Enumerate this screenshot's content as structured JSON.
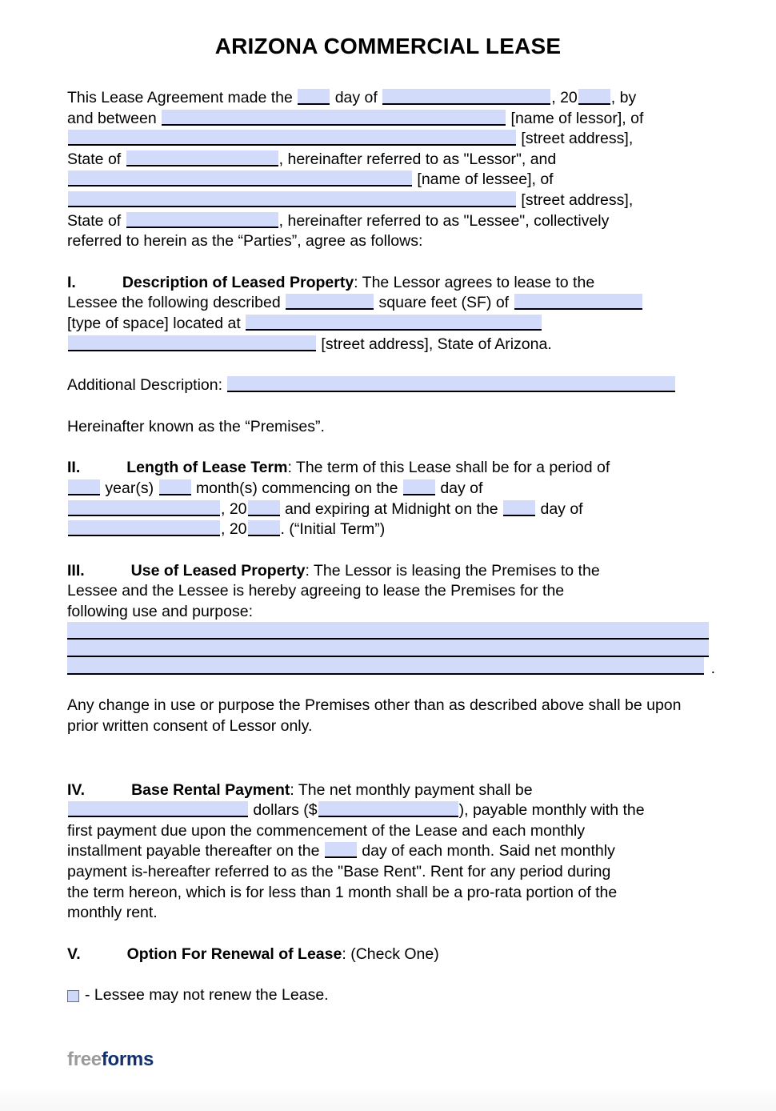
{
  "document": {
    "title": "ARIZONA COMMERCIAL LEASE"
  },
  "intro": {
    "l1_a": "This Lease Agreement made the",
    "l1_b": "day of",
    "l1_c": ", 20",
    "l1_d": ", by",
    "l2_a": "and between",
    "l2_b": "[name of lessor], of",
    "l3_b": "[street address],",
    "l4_a": "State of",
    "l4_b": ", hereinafter referred to as \"Lessor\", and",
    "l5_b": "[name of lessee], of",
    "l6_b": "[street address],",
    "l7_a": "State of",
    "l7_b": ", hereinafter referred to as \"Lessee\", collectively",
    "l8": "referred to herein as the “Parties”, agree as follows:"
  },
  "section_1": {
    "number": "I.",
    "heading": "Description of Leased Property",
    "t1": ": The Lessor agrees to lease to the",
    "t2": "Lessee the following described",
    "t3": "square feet (SF) of",
    "t4": "[type of space] located at",
    "t5": "[street address], State of Arizona."
  },
  "additional_description": {
    "label": "Additional Description:"
  },
  "premises_note": {
    "text": "Hereinafter known as the “Premises”."
  },
  "section_2": {
    "number": "II.",
    "heading": "Length of Lease Term",
    "t1": ": The term of this Lease shall be for a period of",
    "t2": "year(s)",
    "t3": "month(s) commencing on the",
    "t4": "day of",
    "t5": ", 20",
    "t6": "and expiring at Midnight on the",
    "t7": "day of",
    "t8": ", 20",
    "t9": ". (“Initial Term”)"
  },
  "section_3": {
    "number": "III.",
    "heading": "Use of Leased Property",
    "t1": ": The Lessor is leasing the Premises to the",
    "t2": "Lessee and the Lessee is hereby agreeing to lease the Premises for the",
    "t3": "following use and purpose:",
    "period": ".",
    "lines": 3,
    "after": "Any change in use or purpose the Premises other than as described above shall be upon prior written consent of Lessor only."
  },
  "section_4": {
    "number": "IV.",
    "heading": "Base Rental Payment",
    "t1": ": The net monthly payment shall be",
    "t2": "dollars ($",
    "t3": "), payable monthly with the",
    "t4": "first payment due upon the commencement of the Lease and each monthly",
    "t5": "installment payable thereafter on the",
    "t6": "day of each month. Said net monthly",
    "t7": "payment is-hereafter referred to as the \"Base Rent\". Rent for any period during",
    "t8": "the term hereon, which is for less than 1 month shall be a pro-rata portion of the",
    "t9": "monthly rent."
  },
  "section_5": {
    "number": "V.",
    "heading": "Option For Renewal of Lease",
    "t1": ": (Check One)",
    "option_1": "- Lessee may not renew the Lease."
  },
  "footer": {
    "logo_part1": "free",
    "logo_part2": "forms",
    "color_part1": "#9a9a9a",
    "color_part2": "#12306e"
  },
  "colors": {
    "form_field_fill": "#d3dbfb",
    "rule": "#000000",
    "text": "#000000"
  }
}
